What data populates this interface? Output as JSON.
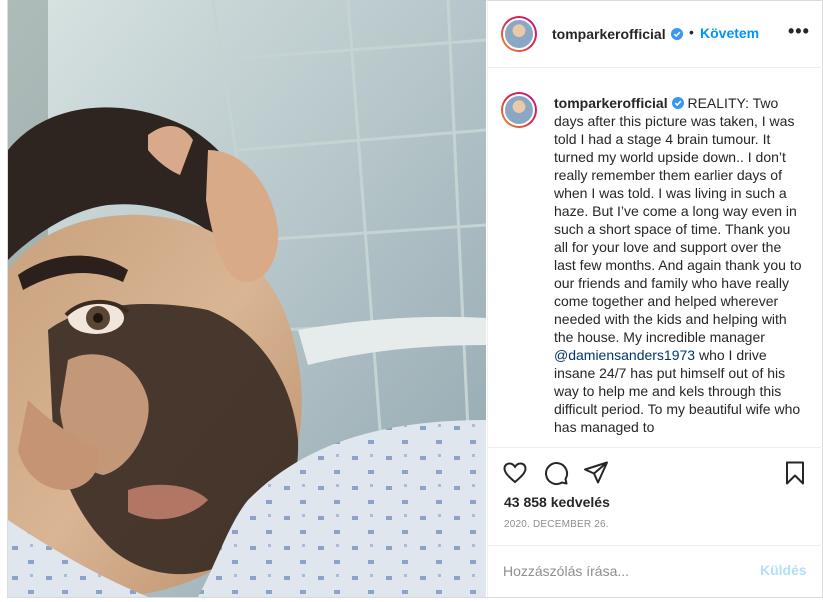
{
  "post": {
    "username": "tomparkerofficial",
    "follow_label": "Követem",
    "separator": "•",
    "more_label": "•••",
    "caption_parts": [
      "REALITY: Two days after this picture was taken, I was told I had a stage 4 brain tumour. It turned my world upside down.. I don’t really remember them earlier days of when I was told. I was living in such a haze. But I’ve come a long way even in such a short space of time. Thank you all for your love and support over the last few months. And again thank you to our friends and family who have really come together and helped wherever needed with the kids and helping with the house. My incredible manager ",
      "@damiensanders1973",
      " who I drive insane 24/7 has put himself out of his way to help me and kels through this difficult period. To my beautiful wife who has managed to"
    ],
    "likes": "43 858 kedvelés",
    "date": "2020. DECEMBER 26.",
    "comment_placeholder": "Hozzászólás írása...",
    "send_label": "Küldés"
  },
  "icons": {
    "like": "heart-icon",
    "comment": "comment-bubble-icon",
    "share": "paper-plane-icon",
    "save": "bookmark-icon",
    "verified": "verified-badge-icon"
  },
  "colors": {
    "accent": "#0095f6",
    "verified": "#3897f0",
    "muted": "#8e8e8e",
    "send_disabled": "#b2dffc",
    "mention": "#00376b",
    "border": "#dbdbdb"
  }
}
